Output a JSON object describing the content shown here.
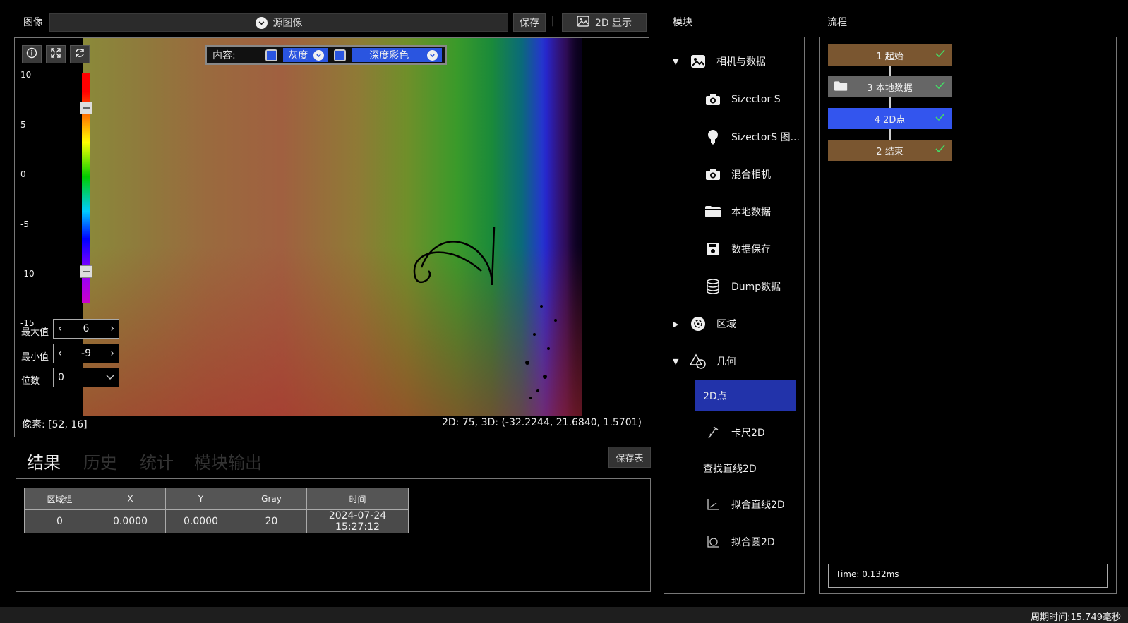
{
  "image_panel": {
    "title": "图像",
    "source_select": "源图像",
    "save_label": "保存",
    "separator": "|",
    "display_label": "2D 显示"
  },
  "viewer": {
    "content_label": "内容:",
    "gray_label": "灰度",
    "depth_color_label": "深度彩色",
    "ticks": [
      "10",
      "5",
      "0",
      "-5",
      "-10",
      "-15"
    ],
    "max_label": "最大值",
    "max_value": "6",
    "min_label": "最小值",
    "min_value": "-9",
    "digits_label": "位数",
    "digits_value": "0",
    "pixel_readout": "像素: [52, 16]",
    "coord_readout": "2D: 75, 3D: (-32.2244, 21.6840, 1.5701)"
  },
  "results": {
    "tabs": [
      "结果",
      "历史",
      "统计",
      "模块输出"
    ],
    "save_table_label": "保存表",
    "columns": [
      "区域组",
      "X",
      "Y",
      "Gray",
      "时间"
    ],
    "rows": [
      [
        "0",
        "0.0000",
        "0.0000",
        "20",
        "2024-07-24 15:27:12"
      ]
    ]
  },
  "modules": {
    "title": "模块",
    "camera_group": "相机与数据",
    "items_camera": [
      "Sizector S",
      "SizectorS 图...",
      "混合相机",
      "本地数据",
      "数据保存",
      "Dump数据"
    ],
    "region_group": "区域",
    "geometry_group": "几何",
    "items_geometry": [
      "2D点",
      "卡尺2D",
      "查找直线2D",
      "拟合直线2D",
      "拟合圆2D"
    ]
  },
  "flow": {
    "title": "流程",
    "steps": [
      "1 起始",
      "3 本地数据",
      "4 2D点",
      "2 结束"
    ],
    "time": "Time: 0.132ms"
  },
  "status": {
    "cycle_time": "周期时间:15.749毫秒"
  },
  "colors": {
    "accent_blue": "#2a55e0",
    "flow_brown": "#7a5630",
    "flow_gray": "#666666",
    "flow_active": "#3355ee",
    "check_green": "#44dd66",
    "tree_selected": "#2233aa"
  }
}
